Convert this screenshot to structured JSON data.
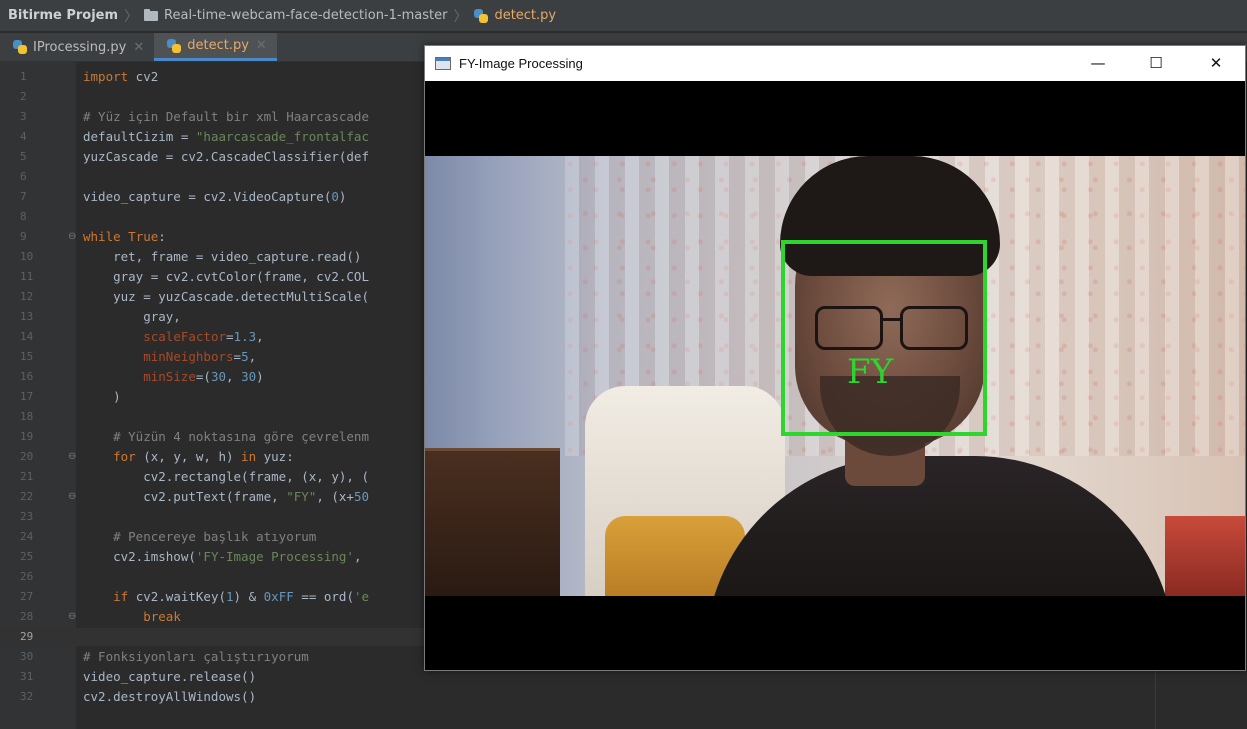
{
  "breadcrumb": {
    "project": "Bitirme Projem",
    "folder": "Real-time-webcam-face-detection-1-master",
    "file": "detect.py"
  },
  "tabs": [
    {
      "label": "IProcessing.py",
      "active": false
    },
    {
      "label": "detect.py",
      "active": true
    }
  ],
  "editor": {
    "current_line": 29,
    "lines": [
      "import cv2",
      "",
      "# Yüz için Default bir xml Haarcascade",
      "defaultCizim = \"haarcascade_frontalfac",
      "yuzCascade = cv2.CascadeClassifier(def",
      "",
      "video_capture = cv2.VideoCapture(0)",
      "",
      "while True:",
      "    ret, frame = video_capture.read()",
      "    gray = cv2.cvtColor(frame, cv2.COL",
      "    yuz = yuzCascade.detectMultiScale(",
      "        gray,",
      "        scaleFactor=1.3,",
      "        minNeighbors=5,",
      "        minSize=(30, 30)",
      "    )",
      "",
      "    # Yüzün 4 noktasına göre çevrelenm",
      "    for (x, y, w, h) in yuz:",
      "        cv2.rectangle(frame, (x, y), (",
      "        cv2.putText(frame, \"FY\", (x+50",
      "",
      "    # Pencereye başlık atıyorum",
      "    cv2.imshow('FY-Image Processing',",
      "",
      "    if cv2.waitKey(1) & 0xFF == ord('e",
      "        break",
      "",
      "# Fonksiyonları çalıştırıyorum",
      "video_capture.release()",
      "cv2.destroyAllWindows()"
    ]
  },
  "popup": {
    "title": "FY-Image Processing",
    "minimize": "—",
    "maximize": "☐",
    "close": "✕",
    "detection_label": "FY"
  },
  "colors": {
    "detection_box": "#2ed52e",
    "editor_bg": "#2b2b2b",
    "keyword": "#cc7832",
    "string": "#6a8759",
    "comment": "#808080",
    "number": "#6897bb",
    "param": "#aa4926"
  }
}
